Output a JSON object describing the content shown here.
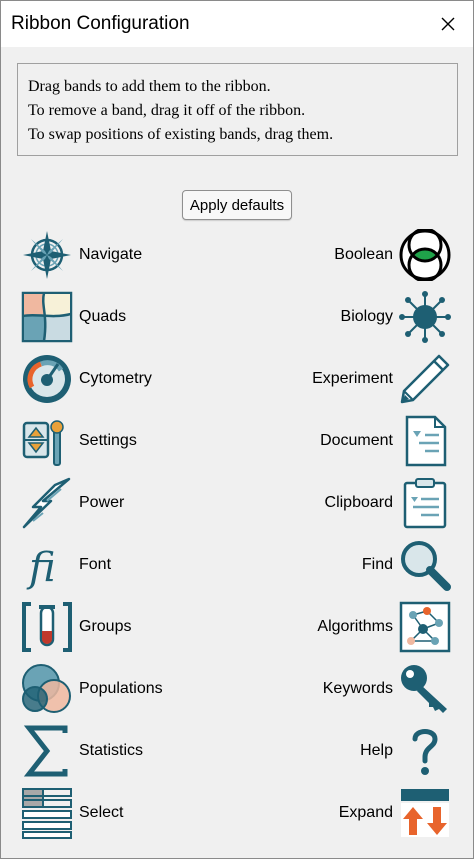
{
  "window": {
    "title": "Ribbon Configuration"
  },
  "instructions": [
    "Drag bands to add them to the ribbon.",
    "To remove a band, drag it off of the ribbon.",
    "To swap positions of existing bands, drag them."
  ],
  "apply_defaults_label": "Apply defaults",
  "left_bands": [
    {
      "label": "Navigate",
      "icon": "compass-rose-icon"
    },
    {
      "label": "Quads",
      "icon": "quadrant-plot-icon"
    },
    {
      "label": "Cytometry",
      "icon": "gauge-dial-icon"
    },
    {
      "label": "Settings",
      "icon": "settings-slider-icon"
    },
    {
      "label": "Power",
      "icon": "lightning-bolt-icon"
    },
    {
      "label": "Font",
      "icon": "font-ligature-icon"
    },
    {
      "label": "Groups",
      "icon": "test-tube-bracket-icon"
    },
    {
      "label": "Populations",
      "icon": "overlapping-circles-icon"
    },
    {
      "label": "Statistics",
      "icon": "sigma-icon"
    },
    {
      "label": "Select",
      "icon": "list-select-icon"
    }
  ],
  "right_bands": [
    {
      "label": "Boolean",
      "icon": "venn-boolean-icon"
    },
    {
      "label": "Biology",
      "icon": "cell-virus-icon"
    },
    {
      "label": "Experiment",
      "icon": "pencil-icon"
    },
    {
      "label": "Document",
      "icon": "document-page-icon"
    },
    {
      "label": "Clipboard",
      "icon": "clipboard-icon"
    },
    {
      "label": "Find",
      "icon": "magnifier-icon"
    },
    {
      "label": "Algorithms",
      "icon": "network-graph-icon"
    },
    {
      "label": "Keywords",
      "icon": "key-icon"
    },
    {
      "label": "Help",
      "icon": "question-mark-icon"
    },
    {
      "label": "Expand",
      "icon": "expand-arrows-icon"
    }
  ],
  "colors": {
    "teal": "#1e5f73",
    "teal_light": "#6aa3b5",
    "accent_green": "#1fa34a",
    "accent_orange": "#e8642c",
    "peach": "#f0b8a0"
  }
}
